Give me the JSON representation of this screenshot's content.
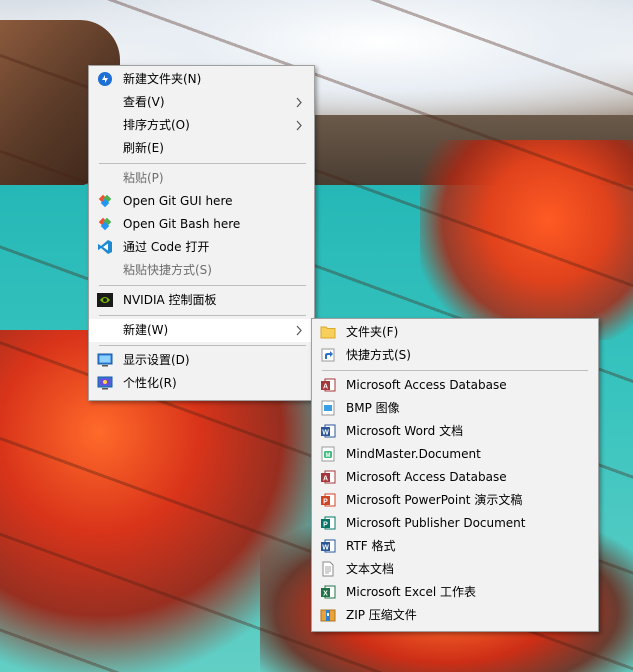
{
  "context_menu": {
    "items": [
      {
        "label": "新建文件夹(N)",
        "icon": "new-folder-icon"
      },
      {
        "label": "查看(V)",
        "has_submenu": true
      },
      {
        "label": "排序方式(O)",
        "has_submenu": true
      },
      {
        "label": "刷新(E)"
      },
      {
        "label": "粘贴(P)",
        "disabled": true
      },
      {
        "label": "Open Git GUI here",
        "icon": "git-gui-icon"
      },
      {
        "label": "Open Git Bash here",
        "icon": "git-bash-icon"
      },
      {
        "label": "通过 Code 打开",
        "icon": "vscode-icon"
      },
      {
        "label": "粘贴快捷方式(S)",
        "disabled": true
      },
      {
        "label": "NVIDIA 控制面板",
        "icon": "nvidia-icon"
      },
      {
        "label": "新建(W)",
        "has_submenu": true,
        "highlighted": true
      },
      {
        "label": "显示设置(D)",
        "icon": "display-settings-icon"
      },
      {
        "label": "个性化(R)",
        "icon": "personalize-icon"
      }
    ]
  },
  "new_submenu": {
    "items": [
      {
        "label": "文件夹(F)",
        "icon": "folder-icon"
      },
      {
        "label": "快捷方式(S)",
        "icon": "shortcut-icon"
      },
      {
        "label": "Microsoft Access Database",
        "icon": "access-icon"
      },
      {
        "label": "BMP 图像",
        "icon": "bmp-icon"
      },
      {
        "label": "Microsoft Word 文档",
        "icon": "word-icon"
      },
      {
        "label": "MindMaster.Document",
        "icon": "mindmaster-icon"
      },
      {
        "label": "Microsoft Access Database",
        "icon": "access-icon"
      },
      {
        "label": "Microsoft PowerPoint 演示文稿",
        "icon": "powerpoint-icon"
      },
      {
        "label": "Microsoft Publisher Document",
        "icon": "publisher-icon"
      },
      {
        "label": "RTF 格式",
        "icon": "rtf-icon"
      },
      {
        "label": "文本文档",
        "icon": "text-document-icon"
      },
      {
        "label": "Microsoft Excel 工作表",
        "icon": "excel-icon"
      },
      {
        "label": "ZIP 压缩文件",
        "icon": "zip-icon"
      }
    ]
  },
  "colors": {
    "menu_background": "#f2f2f2",
    "menu_border": "#a0a0a0",
    "highlight": "#ffffff",
    "disabled_text": "#6d6d6d"
  }
}
